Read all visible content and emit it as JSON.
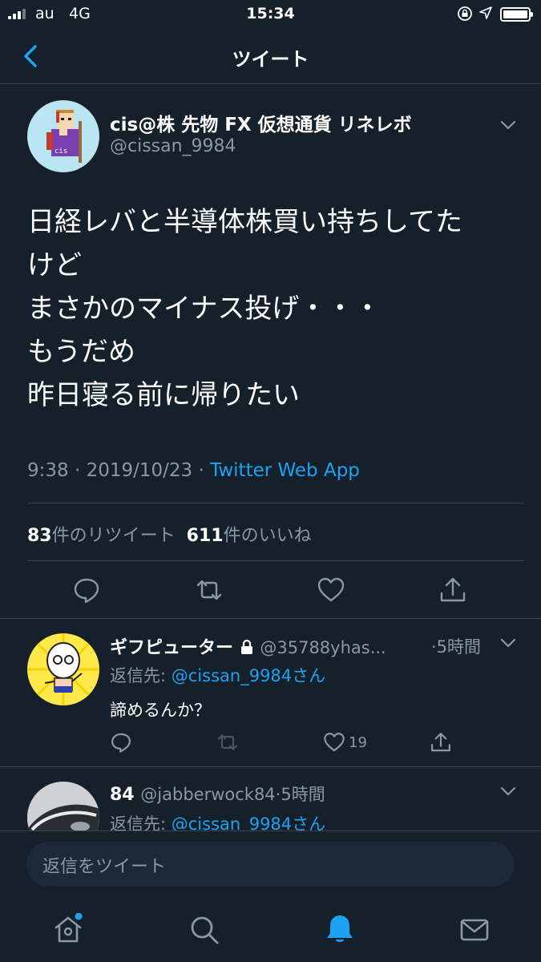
{
  "status_bar": {
    "carrier": "au",
    "network": "4G",
    "time": "15:34"
  },
  "nav": {
    "title": "ツイート",
    "back_icon": "chevron-left-icon"
  },
  "tweet": {
    "display_name": "cis@株 先物 FX 仮想通貨 リネレボ",
    "handle": "@cissan_9984",
    "avatar_text": "cis",
    "text": "日経レバと半導体株買い持ちしてた\nけど\nまさかのマイナス投げ・・・\nもうだめ\n昨日寝る前に帰りたい",
    "time": "9:38",
    "date": "2019/10/23",
    "source": "Twitter Web App",
    "retweet_count": "83",
    "retweet_label": "件のリツイート",
    "like_count": "611",
    "like_label": "件のいいね",
    "actions": [
      "reply-icon",
      "retweet-icon",
      "like-icon",
      "share-icon"
    ]
  },
  "replies": [
    {
      "display_name": "ギフピューター",
      "handle": "@35788yhas...",
      "time": "·5時間",
      "reply_to_prefix": "返信先: ",
      "reply_to": "@cissan_9984さん",
      "text": "諦めるんか？",
      "like_count": "19"
    },
    {
      "display_name": "84",
      "handle": "@jabberwock84",
      "time": "·5時間",
      "reply_to_prefix": "返信先: ",
      "reply_to": "@cissan_9984さん"
    }
  ],
  "composer": {
    "placeholder": "返信をツイート"
  },
  "tabbar": [
    "home-icon",
    "search-icon",
    "notifications-icon",
    "messages-icon"
  ],
  "colors": {
    "background": "#15202b",
    "accent": "#1da1f2",
    "secondary_text": "#8899a6",
    "divider": "#38444d"
  }
}
